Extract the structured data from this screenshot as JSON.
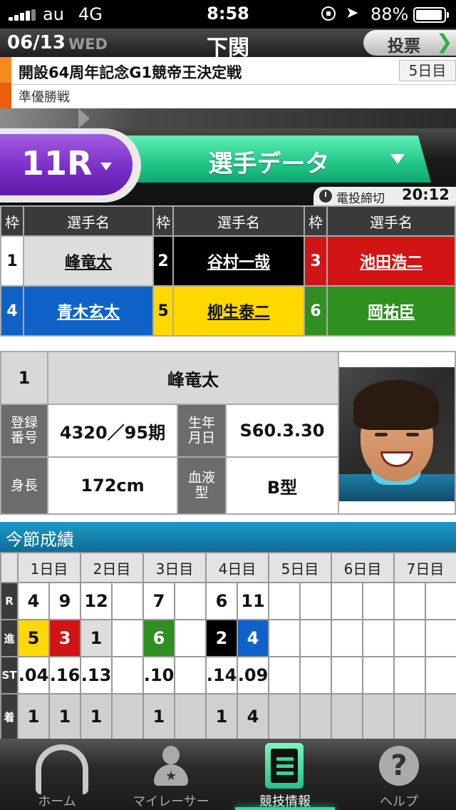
{
  "status": {
    "carrier": "au",
    "network": "4G",
    "time": "8:58",
    "battery": "88%"
  },
  "header": {
    "date": "06/13",
    "dow": "WED",
    "venue": "下関",
    "vote_label": "投票",
    "vote_arrow": "❯"
  },
  "race": {
    "name": "開設64周年記念G1競帝王決定戦",
    "day": "5日目",
    "stage": "準優勝戦"
  },
  "race_select": {
    "label": "11R",
    "arrow": "▼"
  },
  "view_select": {
    "label": "選手データ",
    "arrow": "▼"
  },
  "deadline": {
    "label": "電投締切",
    "time": "20:12"
  },
  "racers": {
    "headers": {
      "waku": "枠",
      "name": "選手名"
    },
    "list": [
      {
        "waku": "1",
        "name": "峰竜太",
        "bg": "#ffffff",
        "fg": "#111111",
        "namebg": "#dddddd"
      },
      {
        "waku": "2",
        "name": "谷村一哉",
        "bg": "#000000",
        "fg": "#ffffff",
        "namebg": "#000000"
      },
      {
        "waku": "3",
        "name": "池田浩二",
        "bg": "#d21414",
        "fg": "#ffffff",
        "namebg": "#d21414"
      },
      {
        "waku": "4",
        "name": "青木玄太",
        "bg": "#0f63c8",
        "fg": "#ffffff",
        "namebg": "#0f63c8"
      },
      {
        "waku": "5",
        "name": "柳生泰二",
        "bg": "#ffd800",
        "fg": "#111111",
        "namebg": "#ffd800"
      },
      {
        "waku": "6",
        "name": "岡祐臣",
        "bg": "#2f8f1f",
        "fg": "#ffffff",
        "namebg": "#2f8f1f"
      }
    ]
  },
  "profile": {
    "waku": "1",
    "name": "峰竜太",
    "reg_label": "登録\n番号",
    "reg_value": "4320／95期",
    "birth_label": "生年\n月日",
    "birth_value": "S60.3.30",
    "height_label": "身長",
    "height_value": "172cm",
    "blood_label": "血液\n型",
    "blood_value": "B型"
  },
  "results": {
    "title": "今節成績",
    "days": [
      "1日目",
      "2日目",
      "3日目",
      "4日目",
      "5日目",
      "6日目",
      "7日目"
    ],
    "row_labels": [
      "R",
      "進",
      "ST",
      "着"
    ],
    "races": [
      "4",
      "9",
      "12",
      "",
      "7",
      "",
      "6",
      "11",
      "",
      "",
      "",
      "",
      "",
      ""
    ],
    "lanes": [
      "5",
      "3",
      "1",
      "",
      "6",
      "",
      "2",
      "4",
      "",
      "",
      "",
      "",
      "",
      ""
    ],
    "st": [
      ".04",
      ".16",
      ".13",
      "",
      ".10",
      "",
      ".14",
      ".09",
      "",
      "",
      "",
      "",
      "",
      ""
    ],
    "finish": [
      "1",
      "1",
      "1",
      "",
      "1",
      "",
      "1",
      "4",
      "",
      "",
      "",
      "",
      "",
      ""
    ],
    "lane_colors": {
      "1": "#dddddd",
      "2": "#000000",
      "3": "#d21414",
      "4": "#0f63c8",
      "5": "#ffd800",
      "6": "#2f8f1f"
    },
    "lane_text": {
      "1": "#111111",
      "2": "#ffffff",
      "3": "#ffffff",
      "4": "#ffffff",
      "5": "#111111",
      "6": "#ffffff"
    }
  },
  "tabs": [
    {
      "label": "ホーム",
      "icon": "home-icon"
    },
    {
      "label": "マイレーサー",
      "icon": "my-racer-icon"
    },
    {
      "label": "競技情報",
      "icon": "race-info-icon"
    },
    {
      "label": "ヘルプ",
      "icon": "help-icon"
    }
  ]
}
